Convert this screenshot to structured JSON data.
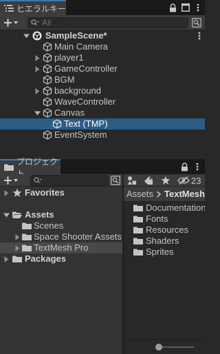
{
  "hierarchy": {
    "tab_title": "ヒエラルキー",
    "search_placeholder": "All",
    "scene": "SampleScene*",
    "items": [
      {
        "label": "Main Camera"
      },
      {
        "label": "player1"
      },
      {
        "label": "GameController"
      },
      {
        "label": "BGM"
      },
      {
        "label": "background"
      },
      {
        "label": "WaveController"
      },
      {
        "label": "Canvas"
      },
      {
        "label": "Text (TMP)"
      },
      {
        "label": "EventSystem"
      }
    ]
  },
  "project": {
    "tab_title": "プロジェクト",
    "hidden_count": "23",
    "favorites": "Favorites",
    "assets": "Assets",
    "asset_children": [
      {
        "label": "Scenes"
      },
      {
        "label": "Space Shooter Assets"
      },
      {
        "label": "TextMesh Pro"
      }
    ],
    "packages": "Packages",
    "breadcrumb": {
      "root": "Assets",
      "current": "TextMesh Pro"
    },
    "folders": [
      {
        "label": "Documentation"
      },
      {
        "label": "Fonts"
      },
      {
        "label": "Resources"
      },
      {
        "label": "Shaders"
      },
      {
        "label": "Sprites"
      }
    ],
    "zoom_level": 0
  },
  "colors": {
    "selection": "#2c5d87",
    "tab_accent": "#3a79bb"
  },
  "icons": [
    "hierarchy-list-icon",
    "lock-icon",
    "maximize-icon",
    "kebab-menu-icon",
    "add-icon",
    "search-icon",
    "unity-logo-icon",
    "gameobject-cube-icon",
    "folder-icon",
    "star-icon",
    "tag-icon",
    "filter-icon",
    "visibility-icon"
  ]
}
